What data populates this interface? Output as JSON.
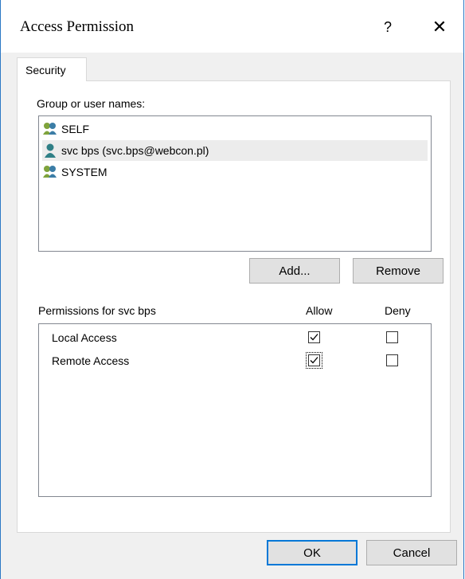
{
  "window": {
    "title": "Access Permission",
    "help_label": "?",
    "close_label": "✕"
  },
  "tabs": [
    {
      "label": "Security",
      "selected": true
    }
  ],
  "users": {
    "label": "Group or user names:",
    "items": [
      {
        "name": "SELF",
        "icon": "group-icon",
        "selected": false
      },
      {
        "name": "svc bps (svc.bps@webcon.pl)",
        "icon": "user-icon",
        "selected": true
      },
      {
        "name": "SYSTEM",
        "icon": "group-icon",
        "selected": false
      }
    ],
    "add_label": "Add...",
    "remove_label": "Remove"
  },
  "permissions": {
    "label": "Permissions for svc bps",
    "allow_header": "Allow",
    "deny_header": "Deny",
    "rows": [
      {
        "name": "Local Access",
        "allow": true,
        "deny": false
      },
      {
        "name": "Remote Access",
        "allow": true,
        "deny": false
      }
    ]
  },
  "footer": {
    "ok_label": "OK",
    "cancel_label": "Cancel"
  },
  "colors": {
    "window_border": "#2b78c5",
    "default_button_border": "#0078d7",
    "group_icon_green": "#7fa33b",
    "user_icon_teal": "#2f7f86"
  }
}
